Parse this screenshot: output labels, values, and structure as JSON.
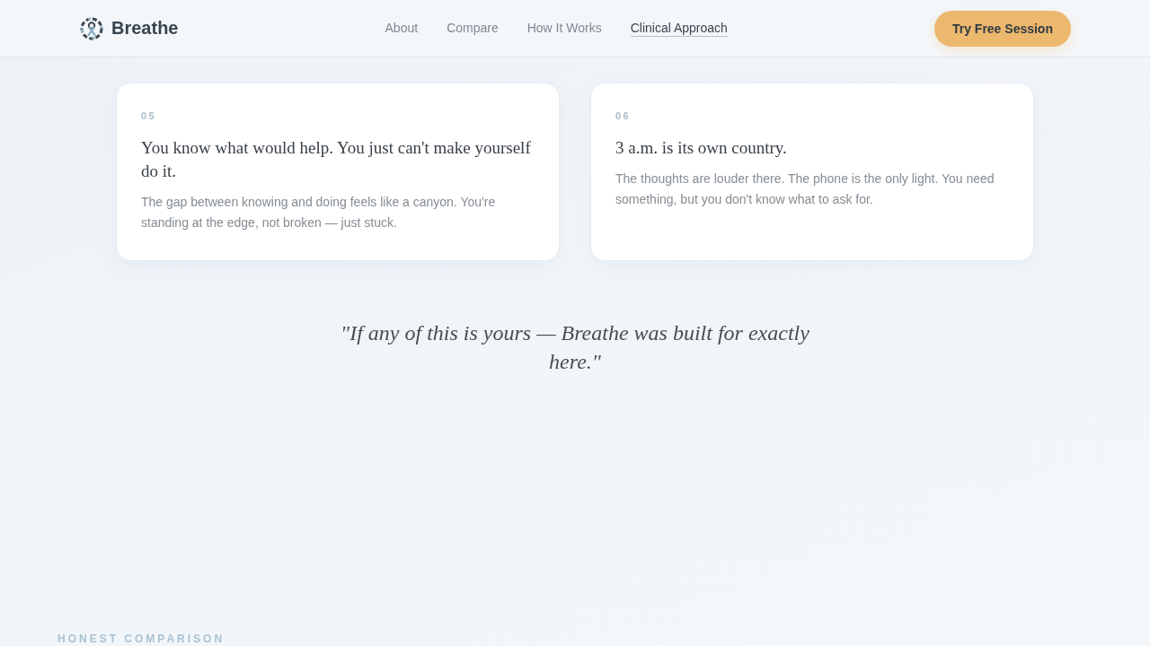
{
  "header": {
    "brand": "Breathe",
    "nav": [
      {
        "label": "About",
        "selected": false
      },
      {
        "label": "Compare",
        "selected": false
      },
      {
        "label": "How It Works",
        "selected": false
      },
      {
        "label": "Clinical Approach",
        "selected": true
      }
    ],
    "cta": "Try Free Session"
  },
  "cards": [
    {
      "number": "05",
      "title": "You know what would help. You just can't make yourself do it.",
      "body": "The gap between knowing and doing feels like a canyon. You're standing at the edge, not broken — just stuck."
    },
    {
      "number": "06",
      "title": "3 a.m. is its own country.",
      "body": "The thoughts are louder there. The phone is the only light. You need something, but you don't know what to ask for."
    }
  ],
  "quote": "\"If any of this is yours — Breathe was built for exactly here.\"",
  "section_label": "HONEST COMPARISON"
}
